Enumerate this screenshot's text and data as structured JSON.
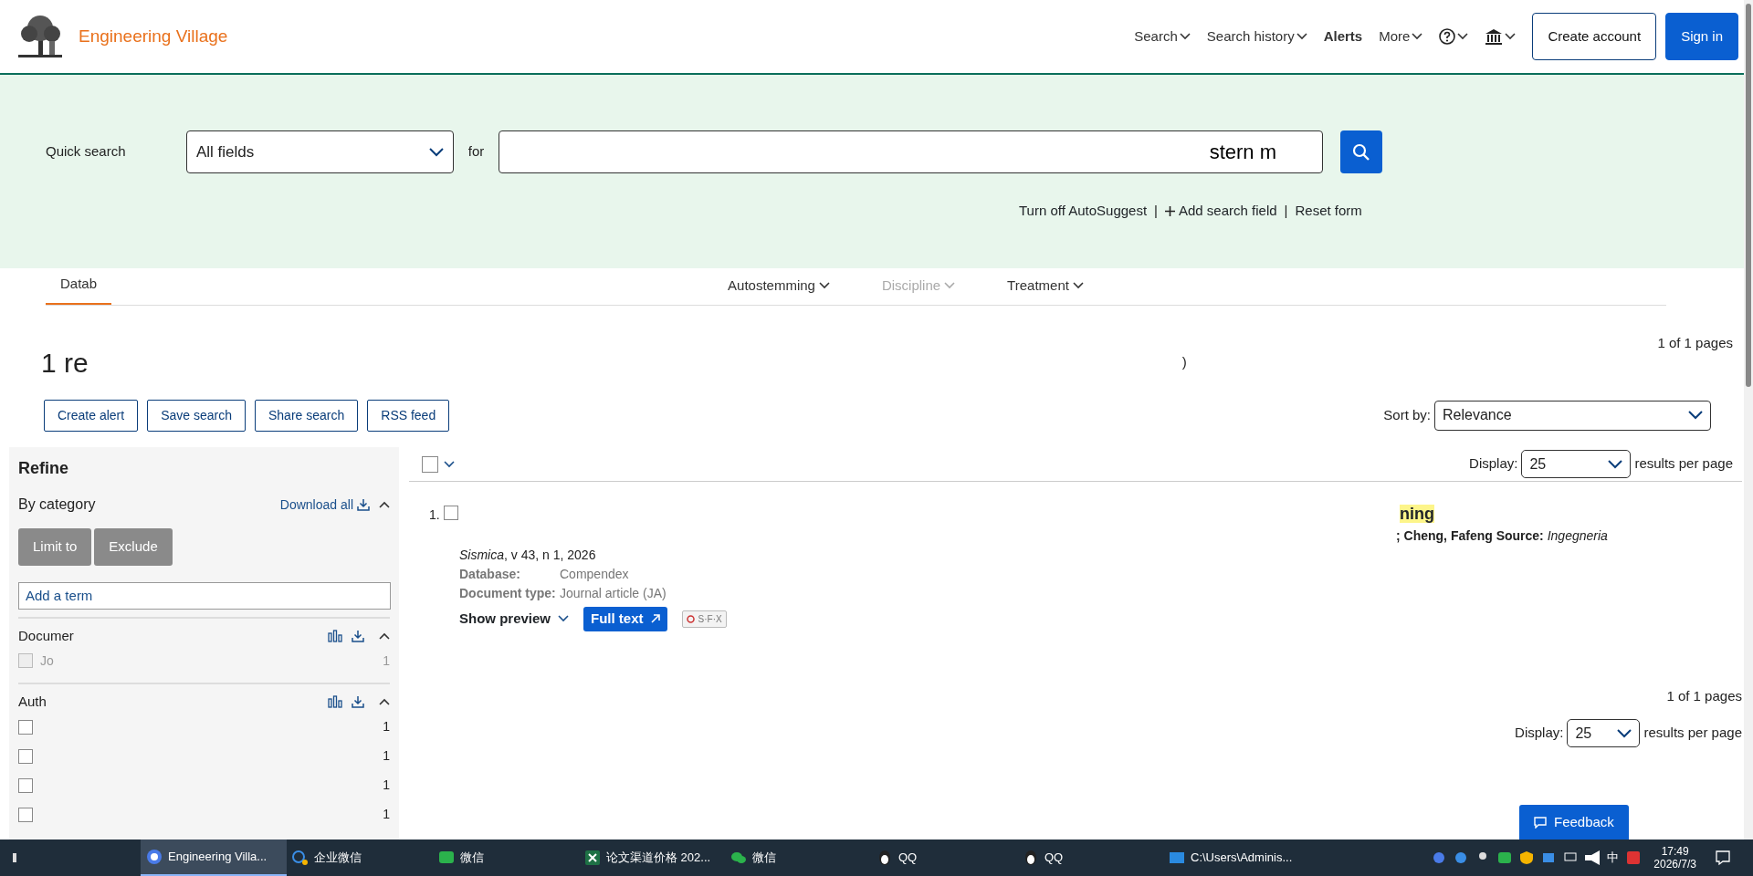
{
  "header": {
    "logo_text": "Engineering Village",
    "nav": [
      {
        "label": "Search",
        "caret": true
      },
      {
        "label": "Search history",
        "caret": true
      },
      {
        "label": "Alerts",
        "caret": false
      },
      {
        "label": "More",
        "caret": true
      }
    ],
    "buttons": [
      {
        "label": "Create account",
        "kind": "outline"
      },
      {
        "label": "Sign in",
        "kind": "primary"
      }
    ]
  },
  "quick_search": {
    "separators": [
      "|",
      "|"
    ],
    "label": "Quick search",
    "field": "All fields",
    "for": "for",
    "value": "stern m",
    "links": [
      {
        "label": "Turn off AutoSuggest",
        "kind": "plain"
      },
      {
        "label": "Add search field",
        "kind": "add"
      },
      {
        "label": "Reset form",
        "kind": "plain"
      }
    ]
  },
  "option_tabs": [
    {
      "label": "Datab",
      "selected": true,
      "disabled": false
    },
    {
      "label": "Autostemming",
      "selected": false,
      "disabled": false
    },
    {
      "label": "Discipline",
      "selected": false,
      "disabled": true
    },
    {
      "label": "Treatment",
      "selected": false,
      "disabled": false
    }
  ],
  "results": {
    "heading": "1 re",
    "heading_tail": ")",
    "pages": "1 of 1 pages",
    "actions": [
      "Create alert",
      "Save search",
      "Share search",
      "RSS feed"
    ],
    "sort_label": "Sort by:",
    "sort_value": "Relevance"
  },
  "refine": {
    "title": "Refine",
    "subtitle": "By category",
    "download_all": "Download all",
    "buttons": [
      "Limit to",
      "Exclude"
    ],
    "term_placeholder": "Add a term",
    "facets": [
      {
        "title": "Documer",
        "items": [
          {
            "label": "Jo",
            "count": "1",
            "checked": false,
            "disabled": true
          }
        ]
      },
      {
        "title": "Auth",
        "items": [
          {
            "count": "1",
            "checked": false,
            "disabled": false
          },
          {
            "count": "1",
            "checked": false,
            "disabled": false
          },
          {
            "count": "1",
            "checked": false,
            "disabled": false
          },
          {
            "count": "1",
            "checked": false,
            "disabled": false
          }
        ]
      }
    ]
  },
  "list": {
    "select_all_checked": false,
    "display_label": "Display:",
    "per_page": "25",
    "suffix": "results per page",
    "records": [
      {
        "number": "1.",
        "checked": false,
        "title": "ning",
        "authors": "**; Cheng, Fafeng Source:** *Ingegneria*",
        "source": "*Sismica*, v 43, n 1, 2026",
        "fields": [
          {
            "label": "Database:",
            "value": "Compendex"
          },
          {
            "label": "Document type:",
            "value": "Journal article (JA)"
          }
        ],
        "preview": "Show preview",
        "full_text": "Full text",
        "sfx": "S·F·X"
      }
    ]
  },
  "footer": {
    "pages": "1 of 1 pages",
    "display_label": "Display:",
    "per_page": "25",
    "suffix": "results per page"
  },
  "feedback": "Feedback",
  "taskbar": {
    "items": [
      {
        "label": "Engineering Villa...",
        "kind": "browser",
        "active": true
      },
      {
        "label": "企业微信",
        "kind": "wecom",
        "active": false
      },
      {
        "label": "微信",
        "kind": "chat",
        "active": false
      },
      {
        "label": "论文渠道价格 202...",
        "kind": "excel",
        "active": false
      },
      {
        "label": "微信",
        "kind": "wechat",
        "active": false
      },
      {
        "label": "QQ",
        "kind": "qq",
        "active": false
      },
      {
        "label": "QQ",
        "kind": "qq",
        "active": false
      },
      {
        "label": "C:\\Users\\Adminis...",
        "kind": "folder",
        "active": false
      }
    ],
    "ime": "中",
    "time": "17:49",
    "date": "2026/7/3"
  }
}
